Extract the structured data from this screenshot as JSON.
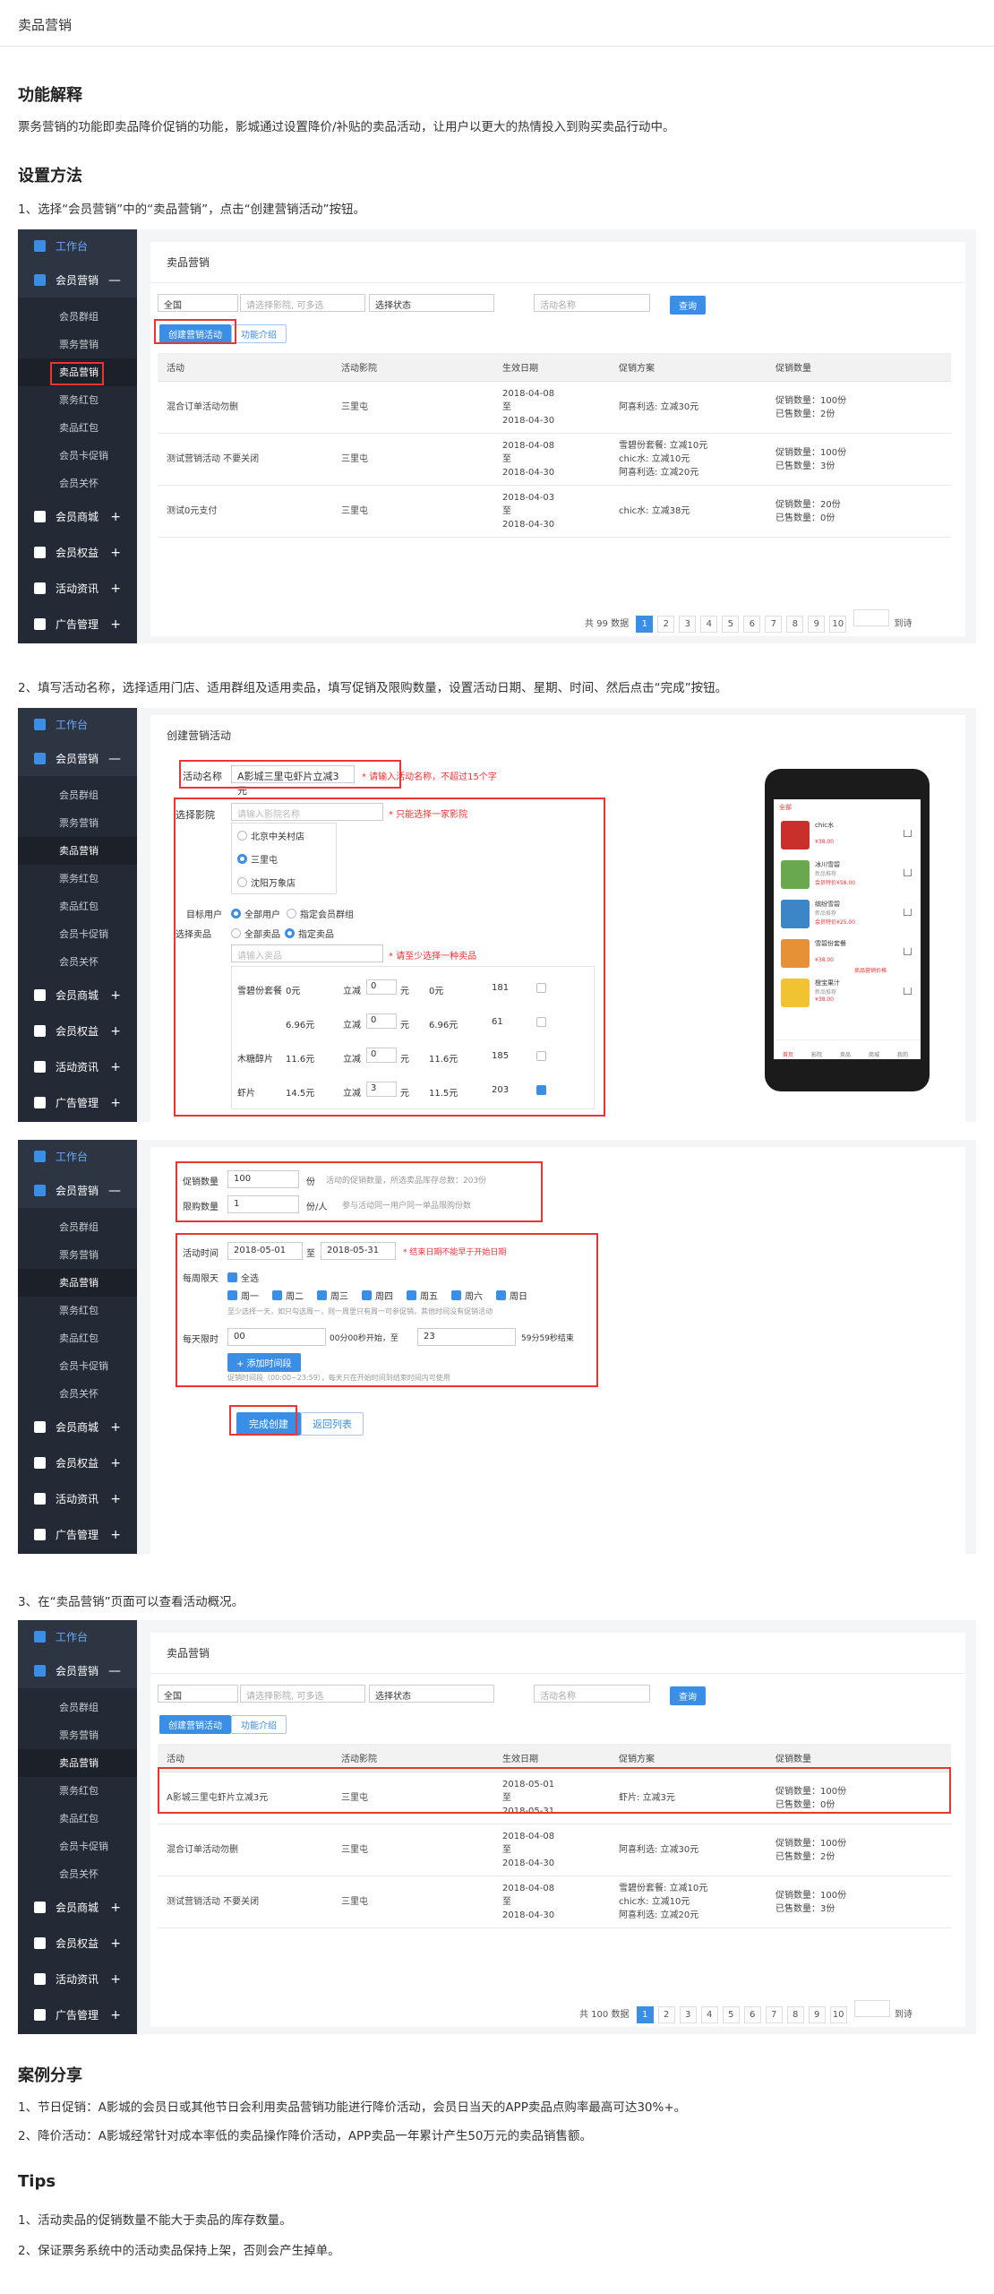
{
  "page_title": "卖品营销",
  "sections": {
    "explain_title": "功能解释",
    "explain_text": "票务营销的功能即卖品降价促销的功能，影城通过设置降价/补贴的卖品活动，让用户以更大的热情投入到购买卖品行动中。",
    "setup_title": "设置方法",
    "step1": "1、选择“会员营销”中的“卖品营销”，点击“创建营销活动”按钮。",
    "step2": "2、填写活动名称，选择适用门店、适用群组及适用卖品，填写促销及限购数量，设置活动日期、星期、时间、然后点击“完成”按钮。",
    "step3": "3、在“卖品营销”页面可以查看活动概况。",
    "case_title": "案例分享",
    "case1": "1、节日促销：A影城的会员日或其他节日会利用卖品营销功能进行降价活动，会员日当天的APP卖品点购率最高可达30%+。",
    "case2": "2、降价活动：A影城经常针对成本率低的卖品操作降价活动，APP卖品一年累计产生50万元的卖品销售额。",
    "tips_title": "Tips",
    "tip1": "1、活动卖品的促销数量不能大于卖品的库存数量。",
    "tip2": "2、保证票务系统中的活动卖品保持上架，否则会产生掉单。"
  },
  "sidebar": {
    "workbench": "工作台",
    "member_marketing": "会员营销",
    "subs": [
      "会员群组",
      "票务营销",
      "卖品营销",
      "票务红包",
      "卖品红包",
      "会员卡促销",
      "会员关怀"
    ],
    "member_mall": "会员商城",
    "member_rights": "会员权益",
    "activity_news": "活动资讯",
    "ad_manage": "广告管理",
    "plus": "+",
    "minus": "—"
  },
  "list": {
    "title": "卖品营销",
    "store_select": "全国",
    "cinema_placeholder": "请选择影院, 可多选",
    "status_select": "选择状态",
    "name_placeholder": "活动名称",
    "search_btn": "查询",
    "create_btn": "创建营销活动",
    "intro_btn": "功能介绍",
    "headers": [
      "活动",
      "活动影院",
      "生效日期",
      "促销方案",
      "促销数量"
    ],
    "rows1": [
      {
        "name": "混合订单活动勿删",
        "cinema": "三里屯",
        "date": [
          "2018-04-08",
          "至",
          "2018-04-30"
        ],
        "plan": [
          "阿喜利选: 立减30元"
        ],
        "qty": [
          "促销数量：100份",
          "已售数量：2份"
        ]
      },
      {
        "name": "测试营销活动 不要关闭",
        "cinema": "三里屯",
        "date": [
          "2018-04-08",
          "至",
          "2018-04-30"
        ],
        "plan": [
          "雪碧份套餐: 立减10元",
          "chic水: 立减10元",
          "阿喜利选: 立减20元"
        ],
        "qty": [
          "促销数量：100份",
          "已售数量：3份"
        ]
      },
      {
        "name": "测试0元支付",
        "cinema": "三里屯",
        "date": [
          "2018-04-03",
          "至",
          "2018-04-30"
        ],
        "plan": [
          "chic水: 立减38元"
        ],
        "qty": [
          "促销数量：20份",
          "已售数量：0份"
        ]
      }
    ],
    "total1": "共 99 数据",
    "total2": "共 100 数据",
    "pages": [
      "1",
      "2",
      "3",
      "4",
      "5",
      "6",
      "7",
      "8",
      "9",
      "10"
    ],
    "jump": "到诗",
    "rows2": [
      {
        "name": "A影城三里屯虾片立减3元",
        "cinema": "三里屯",
        "date": [
          "2018-05-01",
          "至",
          "2018-05-31"
        ],
        "plan": [
          "虾片: 立减3元"
        ],
        "qty": [
          "促销数量：100份",
          "已售数量：0份"
        ]
      },
      {
        "name": "混合订单活动勿删",
        "cinema": "三里屯",
        "date": [
          "2018-04-08",
          "至",
          "2018-04-30"
        ],
        "plan": [
          "阿喜利选: 立减30元"
        ],
        "qty": [
          "促销数量：100份",
          "已售数量：2份"
        ]
      },
      {
        "name": "测试营销活动 不要关闭",
        "cinema": "三里屯",
        "date": [
          "2018-04-08",
          "至",
          "2018-04-30"
        ],
        "plan": [
          "雪碧份套餐: 立减10元",
          "chic水: 立减10元",
          "阿喜利选: 立减20元"
        ],
        "qty": [
          "促销数量：100份",
          "已售数量：3份"
        ]
      }
    ]
  },
  "create": {
    "title": "创建营销活动",
    "name_label": "活动名称",
    "name_value": "A影城三里屯虾片立减3元",
    "name_hint": "* 请输入活动名称，不超过15个字",
    "cinema_label": "选择影院",
    "cinema_placeholder": "请输入影院名称",
    "cinema_hint": "* 只能选择一家影院",
    "cinemas": [
      "北京中关村店",
      "三里屯",
      "沈阳万象店"
    ],
    "target_label": "目标用户",
    "target_all": "全部用户",
    "target_group": "指定会员群组",
    "goods_label": "选择卖品",
    "goods_all": "全部卖品",
    "goods_spec": "指定卖品",
    "goods_placeholder": "请输入卖品",
    "goods_hint": "* 请至少选择一种卖品",
    "goods": [
      {
        "name": "雪碧份套餐",
        "price": "0元",
        "minus": "立减",
        "val": "0",
        "unit": "元",
        "after": "0元",
        "stock": "181"
      },
      {
        "name": "",
        "price": "6.96元",
        "minus": "立减",
        "val": "0",
        "unit": "元",
        "after": "6.96元",
        "stock": "61"
      },
      {
        "name": "木糖醇片",
        "price": "11.6元",
        "minus": "立减",
        "val": "0",
        "unit": "元",
        "after": "11.6元",
        "stock": "185"
      },
      {
        "name": "虾片",
        "price": "14.5元",
        "minus": "立减",
        "val": "3",
        "unit": "元",
        "after": "11.5元",
        "stock": "203"
      }
    ],
    "promo_label": "促销数量",
    "promo_value": "100",
    "promo_unit": "份",
    "promo_hint": "活动的促销数量，所选卖品库存总数：203份",
    "limit_label": "限购数量",
    "limit_value": "1",
    "limit_unit": "份/人",
    "limit_hint": "参与活动同一用户同一单品限购份数",
    "time_label": "活动时间",
    "date_start": "2018-05-01",
    "date_to": "至",
    "date_end": "2018-05-31",
    "date_hint": "* 结束日期不能早于开始日期",
    "week_label": "每周限天",
    "week_all": "全选",
    "weekdays": [
      "周一",
      "周二",
      "周三",
      "周四",
      "周五",
      "周六",
      "周日"
    ],
    "week_hint": "至少选择一天，如只勾选周一，则一周里只有周一可参促销，其他时间没有促销活动",
    "daily_label": "每天限时",
    "daily_start": "00",
    "daily_mid": "00分00秒开始，至",
    "daily_end": "23",
    "daily_tail": "59分59秒结束",
    "add_period": "+ 添加时间段",
    "period_hint": "促销时间段（00:00~23:59），每天只在开始时间到结束时间内可使用",
    "finish_btn": "完成创建",
    "back_btn": "返回列表"
  },
  "phone": {
    "tab": "全部",
    "items": [
      {
        "name": "chic水",
        "sub": "",
        "price": "¥38.00",
        "color": "#c9302c"
      },
      {
        "name": "冰川雪碧",
        "sub": "新品推荐",
        "price": "会员特价¥58.00",
        "color": "#6aa84f"
      },
      {
        "name": "缤纷雪碧",
        "sub": "新品推荐",
        "price": "会员特价¥25.00",
        "color": "#3d85c6"
      },
      {
        "name": "雪碧份套餐",
        "sub": "",
        "price": "¥38.00",
        "color": "#e69138"
      },
      {
        "name": "橙宝果汁",
        "sub": "新品推荐",
        "price": "¥38.00",
        "color": "#f1c232"
      }
    ],
    "badge": "卖品营销价格",
    "nav": [
      "首页",
      "影院",
      "卖品",
      "商城",
      "我的"
    ]
  }
}
